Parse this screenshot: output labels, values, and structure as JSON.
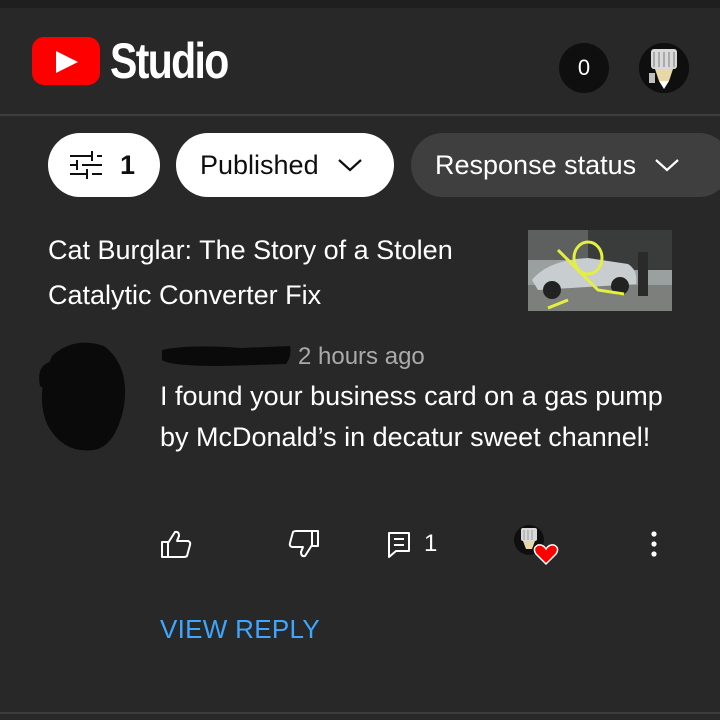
{
  "header": {
    "app_name": "Studio",
    "notifications_count": "0"
  },
  "filters": {
    "filter_count": "1",
    "published_label": "Published",
    "response_status_label": "Response status"
  },
  "video": {
    "title": "Cat Burglar: The Story of a Stolen Catalytic Converter Fix"
  },
  "comment": {
    "timestamp": "2 hours ago",
    "text": "I found your business card on a gas pump by McDonald’s in decatur sweet channel!",
    "reply_count": "1",
    "view_reply_label": "VIEW REPLY"
  },
  "colors": {
    "background": "#282828",
    "brand_red": "#ff0000",
    "link_blue": "#3ea6ff",
    "chip_light": "#ffffff",
    "chip_dark": "#3f3f3f",
    "muted_text": "#aaaaaa"
  },
  "icons": {
    "logo": "youtube-logo",
    "filter": "filter-sliders-icon",
    "chevron": "chevron-down-icon",
    "like": "thumbs-up-icon",
    "dislike": "thumbs-down-icon",
    "reply": "reply-comment-icon",
    "heart": "creator-heart-icon",
    "more": "more-vert-icon"
  }
}
